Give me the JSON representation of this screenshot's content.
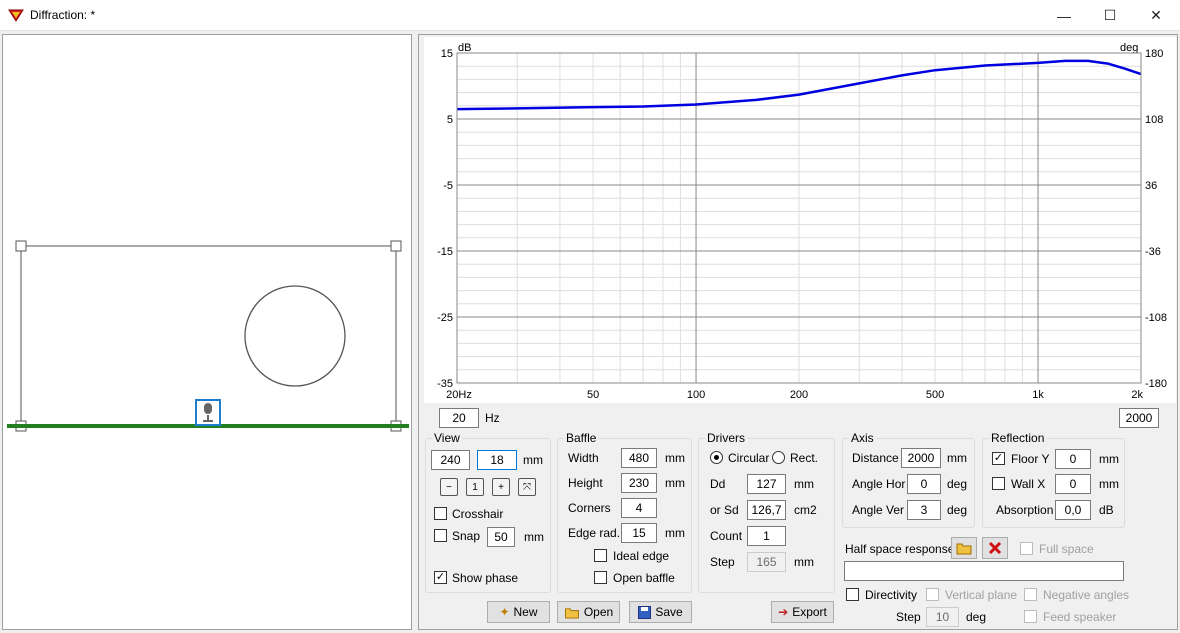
{
  "window": {
    "title": "Diffraction: *",
    "minimize": "—",
    "maximize": "☐",
    "close": "✕"
  },
  "chart_data": {
    "type": "line",
    "x_scale": "log",
    "xlim": [
      20,
      2000
    ],
    "x_ticks": [
      20,
      50,
      100,
      200,
      500,
      1000,
      2000
    ],
    "x_tick_labels": [
      "20Hz",
      "50",
      "100",
      "200",
      "500",
      "1k",
      "2k"
    ],
    "ylabel_left": "dB",
    "ylim_left": [
      -35,
      15
    ],
    "y_ticks_left": [
      15,
      5,
      -5,
      -15,
      -25,
      -35
    ],
    "ylabel_right": "deg",
    "ylim_right": [
      -180,
      180
    ],
    "y_ticks_right": [
      180,
      108,
      36,
      -36,
      -108,
      -180
    ],
    "grid": true,
    "series": [
      {
        "color": "#0000e0",
        "x": [
          20,
          30,
          50,
          70,
          100,
          150,
          200,
          300,
          400,
          500,
          700,
          1000,
          1200,
          1400,
          1600,
          1800,
          2000
        ],
        "y": [
          6.5,
          6.6,
          6.8,
          6.9,
          7.2,
          7.9,
          8.7,
          10.4,
          11.6,
          12.4,
          13.1,
          13.5,
          13.8,
          13.8,
          13.4,
          12.6,
          11.8
        ]
      }
    ]
  },
  "range": {
    "min": "20",
    "unit": "Hz",
    "max": "2000"
  },
  "view": {
    "title": "View",
    "val1": "240",
    "val2": "18",
    "unit": "mm",
    "crosshair": "Crosshair",
    "snap": "Snap",
    "snap_val": "50",
    "snap_unit": "mm",
    "show_phase": "Show phase",
    "show_phase_checked": true
  },
  "baffle": {
    "title": "Baffle",
    "width_label": "Width",
    "width": "480",
    "height_label": "Height",
    "height": "230",
    "corners_label": "Corners",
    "corners": "4",
    "edge_label": "Edge rad.",
    "edge": "15",
    "unit": "mm",
    "ideal_edge": "Ideal edge",
    "open_baffle": "Open baffle"
  },
  "drivers": {
    "title": "Drivers",
    "circular": "Circular",
    "rect": "Rect.",
    "dd_label": "Dd",
    "dd": "127",
    "dd_unit": "mm",
    "sd_label": "or Sd",
    "sd": "126,7",
    "sd_unit": "cm2",
    "count_label": "Count",
    "count": "1",
    "step_label": "Step",
    "step": "165",
    "step_unit": "mm"
  },
  "axis": {
    "title": "Axis",
    "distance_label": "Distance",
    "distance": "2000",
    "distance_unit": "mm",
    "hor_label": "Angle Hor",
    "hor": "0",
    "ver_label": "Angle Ver",
    "ver": "3",
    "deg": "deg"
  },
  "reflection": {
    "title": "Reflection",
    "floor_label": "Floor Y",
    "floor": "0",
    "floor_checked": true,
    "wall_label": "Wall  X",
    "wall": "0",
    "unit": "mm",
    "abs_label": "Absorption",
    "abs": "0,0",
    "abs_unit": "dB"
  },
  "halfspace": {
    "label": "Half space response",
    "full_space": "Full space",
    "directivity": "Directivity",
    "vertical_plane": "Vertical plane",
    "negative_angles": "Negative angles",
    "step_label": "Step",
    "step": "10",
    "step_unit": "deg",
    "feed_speaker": "Feed speaker"
  },
  "buttons": {
    "new": "New",
    "open": "Open",
    "save": "Save",
    "export": "Export"
  }
}
